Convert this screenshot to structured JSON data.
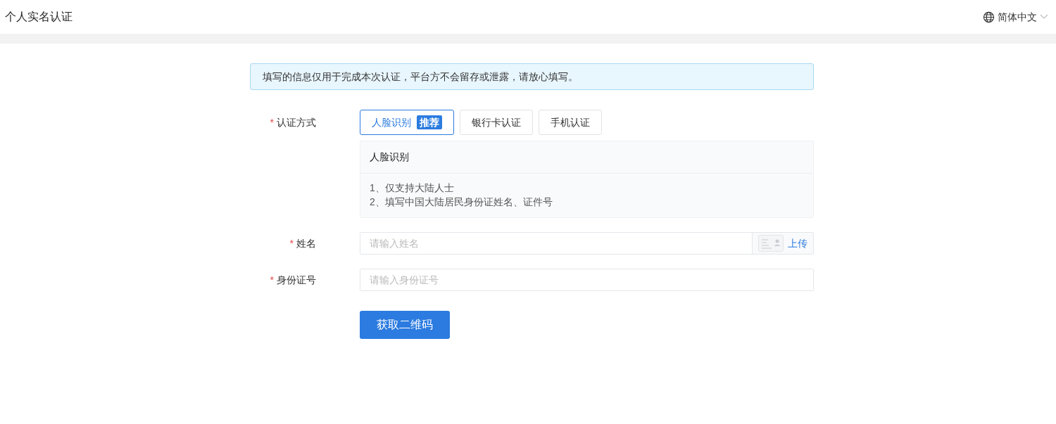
{
  "header": {
    "title": "个人实名认证",
    "language": "简体中文"
  },
  "notice": "填写的信息仅用于完成本次认证，平台方不会留存或泄露，请放心填写。",
  "method_field": {
    "required_mark": "*",
    "label": "认证方式",
    "methods": [
      {
        "label": "人脸识别",
        "badge": "推荐",
        "selected": true
      },
      {
        "label": "银行卡认证",
        "selected": false
      },
      {
        "label": "手机认证",
        "selected": false
      }
    ],
    "info": {
      "title": "人脸识别",
      "lines": [
        "1、仅支持大陆人士",
        "2、填写中国大陆居民身份证姓名、证件号"
      ]
    }
  },
  "fields": [
    {
      "required_mark": "*",
      "label": "姓名",
      "placeholder": "请输入姓名",
      "upload": "上传"
    },
    {
      "required_mark": "*",
      "label": "身份证号",
      "placeholder": "请输入身份证号"
    }
  ],
  "submit": "获取二维码"
}
